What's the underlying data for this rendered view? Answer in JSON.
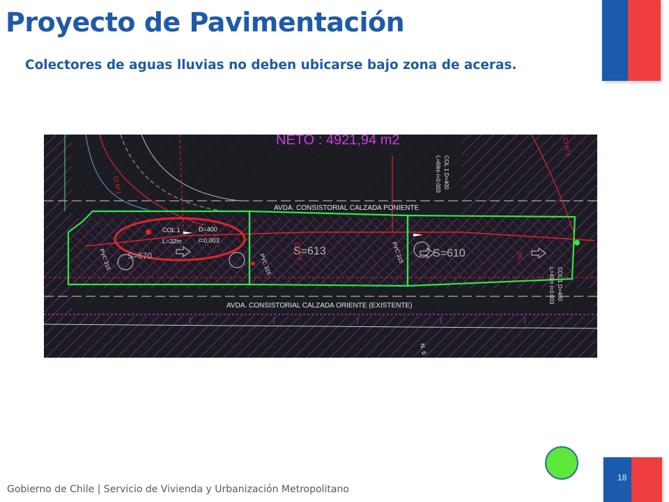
{
  "slide": {
    "title": "Proyecto de Pavimentación",
    "subtitle": "Colectores de aguas lluvias no deben ubicarse bajo zona de aceras.",
    "page_number": "18",
    "footer": "Gobierno de Chile | Servicio de Vivienda y Urbanización Metropolitano"
  },
  "plan": {
    "neto_label": "NETO : 4921,94 m2",
    "street_north": "AVDA. CONSISTORIAL CALZADA PONIENTE",
    "street_south": "AVDA. CONSISTORIAL CALZADA ORIENTE (EXISTENTE)",
    "highlight_col": "COL 1",
    "highlight_d": "D=400",
    "highlight_l": "L=32m",
    "highlight_i": "i=0.003",
    "area_1": "S=613",
    "area_2": "S=610",
    "area_3": "S=670",
    "col_top_1": "COL 1  D=400",
    "col_top_2": "L=69m  i=0.003",
    "col_right_1": "COL 1  D=400",
    "col_right_2": "L=41m  i=0.003",
    "cl_1": "CI N°1",
    "cl_2": "CI N°2",
    "cl_3": "CI N°3",
    "pvc_1": "PVC 315",
    "pvc_2": "PVC 315",
    "pvc_3": "PVC 315",
    "slope": "3%",
    "n_label": "N. 6"
  },
  "colors": {
    "title_blue": "#1f5aa6",
    "flag_blue": "#1a5bab",
    "flag_red": "#ee3e3f",
    "plan_background": "#1b1c22",
    "lot_outline": "#2ee84a",
    "collector_red": "#e0262b",
    "hatch_magenta": "#8c2e8a",
    "indicator_green": "#5fe83c"
  }
}
